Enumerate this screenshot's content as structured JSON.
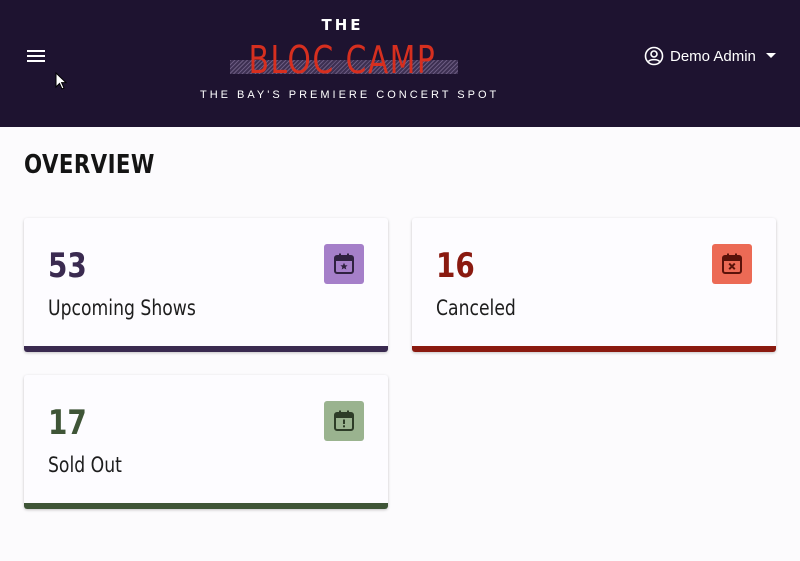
{
  "header": {
    "logo_the": "THE",
    "logo_main": "BLOC CAMP",
    "logo_tagline": "THE BAY'S PREMIERE CONCERT SPOT",
    "user_name": "Demo Admin",
    "bg_color": "#1e1330",
    "accent_color": "#d62f1f"
  },
  "page": {
    "title": "OVERVIEW"
  },
  "cards": [
    {
      "value": "53",
      "label": "Upcoming Shows",
      "icon": "calendar-star-icon",
      "color": "#3a2a50",
      "icon_bg": "#a57fc9"
    },
    {
      "value": "16",
      "label": "Canceled",
      "icon": "calendar-x-icon",
      "color": "#8a1a10",
      "icon_bg": "#ec6a55"
    },
    {
      "value": "17",
      "label": "Sold Out",
      "icon": "calendar-alert-icon",
      "color": "#3f5537",
      "icon_bg": "#9ab38f"
    }
  ]
}
